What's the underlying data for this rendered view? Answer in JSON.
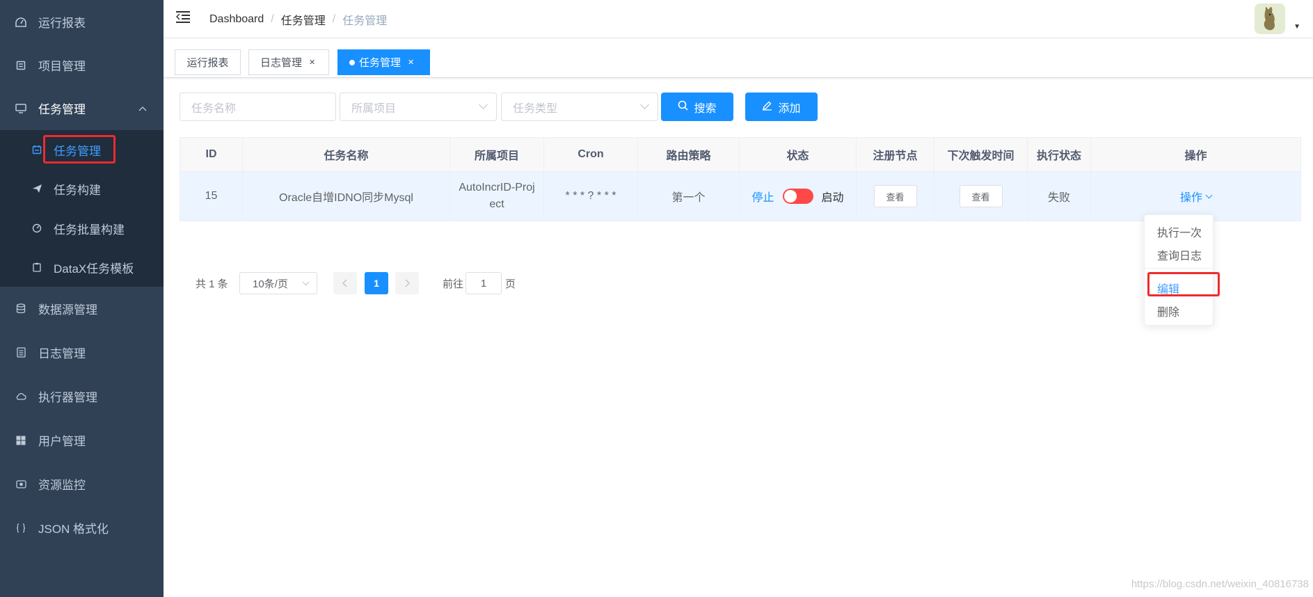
{
  "sidebar": {
    "items": [
      {
        "label": "运行报表",
        "icon": "dashboard-icon"
      },
      {
        "label": "项目管理",
        "icon": "project-icon"
      },
      {
        "label": "任务管理",
        "icon": "monitor-icon",
        "expanded": true
      },
      {
        "label": "数据源管理",
        "icon": "database-icon"
      },
      {
        "label": "日志管理",
        "icon": "document-icon"
      },
      {
        "label": "执行器管理",
        "icon": "cloud-icon"
      },
      {
        "label": "用户管理",
        "icon": "grid-icon"
      },
      {
        "label": "资源监控",
        "icon": "monitor-camera-icon"
      },
      {
        "label": "JSON 格式化",
        "icon": "braces-icon"
      }
    ],
    "subitems": [
      {
        "label": "任务管理",
        "icon": "calendar-icon",
        "active": true
      },
      {
        "label": "任务构建",
        "icon": "send-icon"
      },
      {
        "label": "任务批量构建",
        "icon": "gauge-icon"
      },
      {
        "label": "DataX任务模板",
        "icon": "clipboard-icon"
      }
    ]
  },
  "navbar": {
    "breadcrumb": [
      "Dashboard",
      "任务管理",
      "任务管理"
    ]
  },
  "tags": [
    {
      "label": "运行报表",
      "closable": false,
      "active": false
    },
    {
      "label": "日志管理",
      "closable": true,
      "active": false
    },
    {
      "label": "任务管理",
      "closable": true,
      "active": true
    }
  ],
  "filters": {
    "task_name_placeholder": "任务名称",
    "project_placeholder": "所属项目",
    "task_type_placeholder": "任务类型",
    "search_label": "搜索",
    "add_label": "添加"
  },
  "table": {
    "headers": [
      "ID",
      "任务名称",
      "所属项目",
      "Cron",
      "路由策略",
      "状态",
      "注册节点",
      "下次触发时间",
      "执行状态",
      "操作"
    ],
    "rows": [
      {
        "id": "15",
        "name": "Oracle自增IDNO同步Mysql",
        "project": "AutoIncrID-Project",
        "cron": "* * * ? * * *",
        "route": "第一个",
        "status_off": "停止",
        "status_on": "启动",
        "status_enabled": false,
        "nodes_btn": "查看",
        "next_btn": "查看",
        "exec_status": "失败",
        "op_label": "操作"
      }
    ]
  },
  "dropdown": {
    "items": [
      "执行一次",
      "查询日志",
      "编辑",
      "删除"
    ]
  },
  "pagination": {
    "total_text": "共 1 条",
    "page_size": "10条/页",
    "current_page": "1",
    "goto_prefix": "前往",
    "goto_value": "1",
    "goto_suffix": "页"
  },
  "watermark": "https://blog.csdn.net/weixin_40816738",
  "colors": {
    "sidebar_bg": "#304156",
    "submenu_bg": "#1f2d3d",
    "primary": "#1890ff",
    "switch_off": "#ff4949",
    "highlight_box": "#f12a2a"
  }
}
